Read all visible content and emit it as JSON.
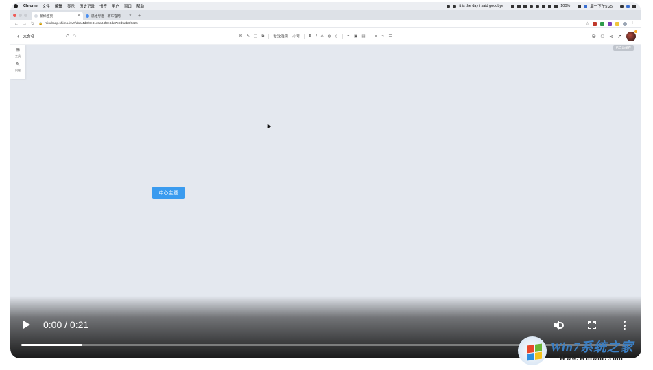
{
  "menubar": {
    "app": "Chrome",
    "items": [
      "文件",
      "编辑",
      "显示",
      "历史记录",
      "书签",
      "用户",
      "窗口",
      "帮助"
    ],
    "now_playing": "it is the day i said goodbye",
    "battery": "100%",
    "clock": "周一下午5:25"
  },
  "tabs": [
    {
      "title": "新标签页"
    },
    {
      "title": "思维导图 - 幕布官网"
    }
  ],
  "address": {
    "url": "mindmap.shimo.im/#/doc/4d3f8e81c8a04f9e8da7e9d5ab8f6c2b"
  },
  "editor": {
    "doc_title": "未命名",
    "tools": [
      "样式",
      "格式",
      "插入",
      "布局",
      "主题",
      "结构",
      "微软雅黑",
      "小号",
      "B",
      "I",
      "A",
      "标签",
      "图标",
      "链接",
      "备注",
      "概要",
      "关联",
      "大纲",
      "导出"
    ],
    "save_status": "已自动保存"
  },
  "leftpanel": {
    "items": [
      {
        "icon": "grid-icon",
        "label": "工具"
      },
      {
        "icon": "paint-icon",
        "label": "风格"
      }
    ]
  },
  "canvas": {
    "central_topic": "中心主题"
  },
  "video": {
    "time": "0:00 / 0:21",
    "progress": 0.1
  },
  "watermark": {
    "title": "Win7系统之家",
    "url": "Www.Winwin7.com"
  },
  "colors": {
    "canvas_bg": "#e4e8ef",
    "accent": "#3a9bef"
  }
}
